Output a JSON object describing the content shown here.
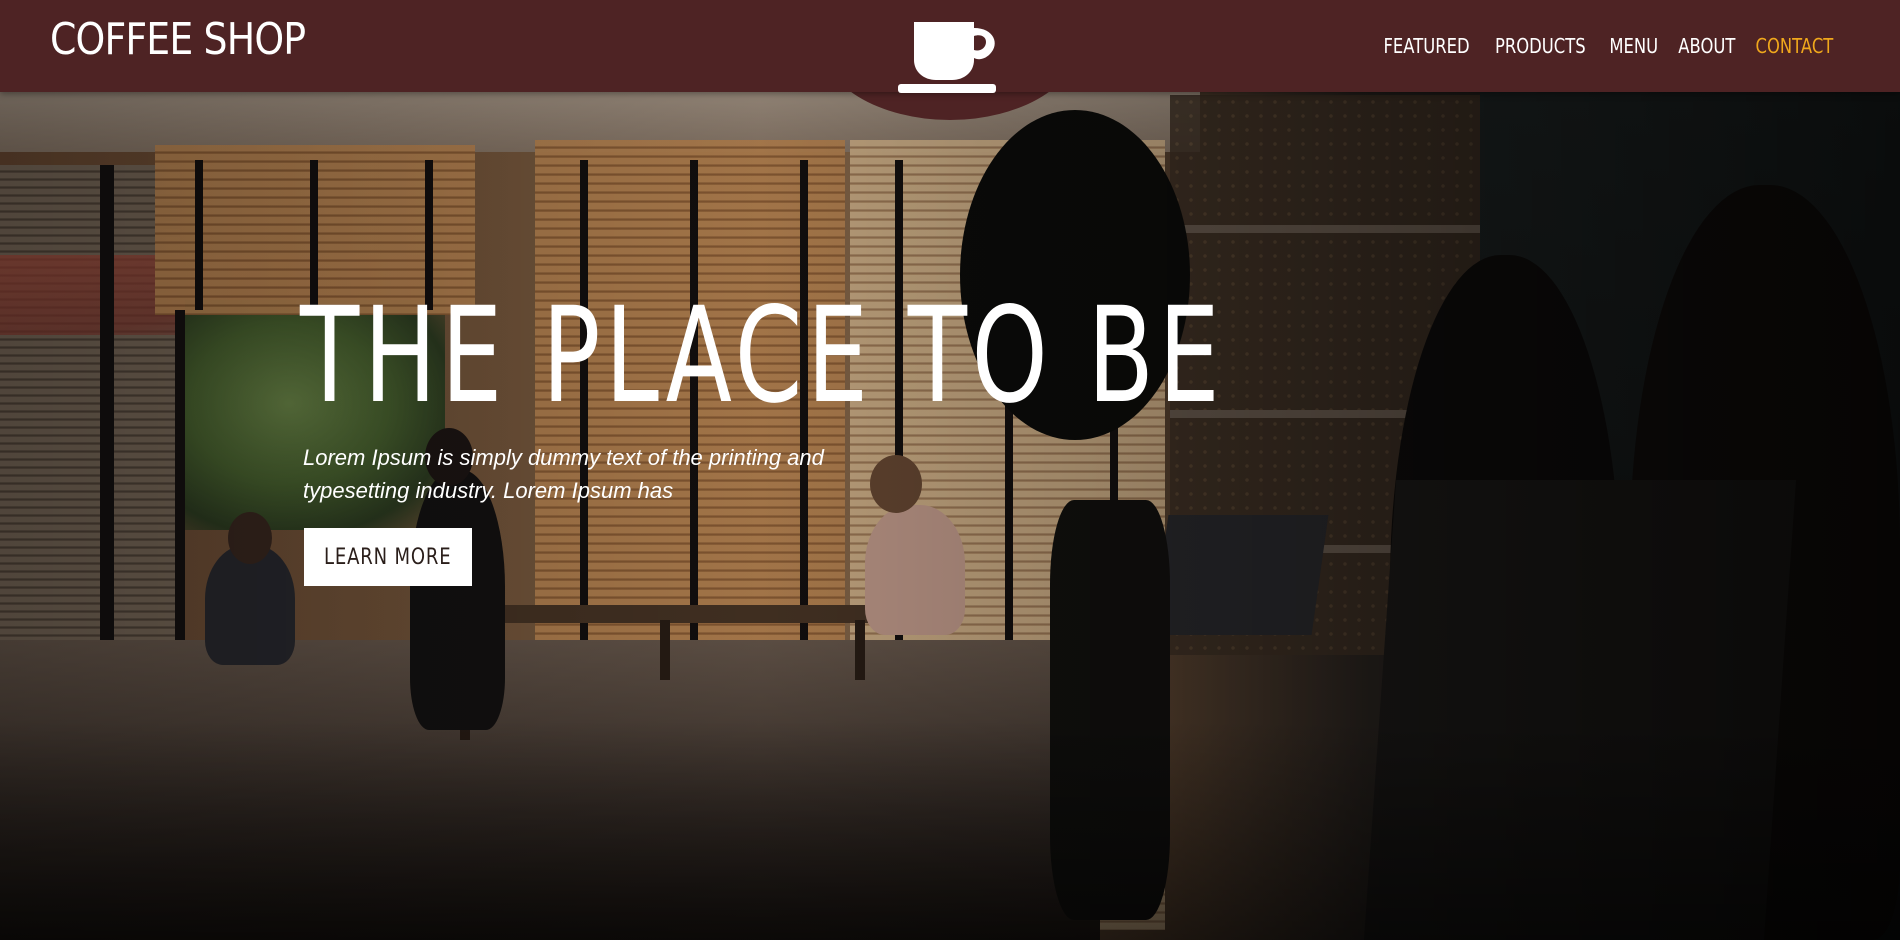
{
  "brand": {
    "name": "COFFEE SHOP",
    "logo_icon": "coffee-cup-icon"
  },
  "nav": {
    "items": [
      {
        "label": "FEATURED",
        "active": false
      },
      {
        "label": "PRODUCTS",
        "active": false
      },
      {
        "label": "MENU",
        "active": false
      },
      {
        "label": "ABOUT",
        "active": false
      },
      {
        "label": "CONTACT",
        "active": true
      }
    ]
  },
  "hero": {
    "title": "THE PLACE TO BE",
    "text": "Lorem Ipsum is simply dummy text of the printing and typesetting industry. Lorem Ipsum has",
    "button_label": "LEARN MORE"
  },
  "colors": {
    "navbar_bg": "#4e2324",
    "active_link": "#f0a81c",
    "text": "#ffffff",
    "button_bg": "#ffffff",
    "button_text": "#2a1e1a"
  }
}
